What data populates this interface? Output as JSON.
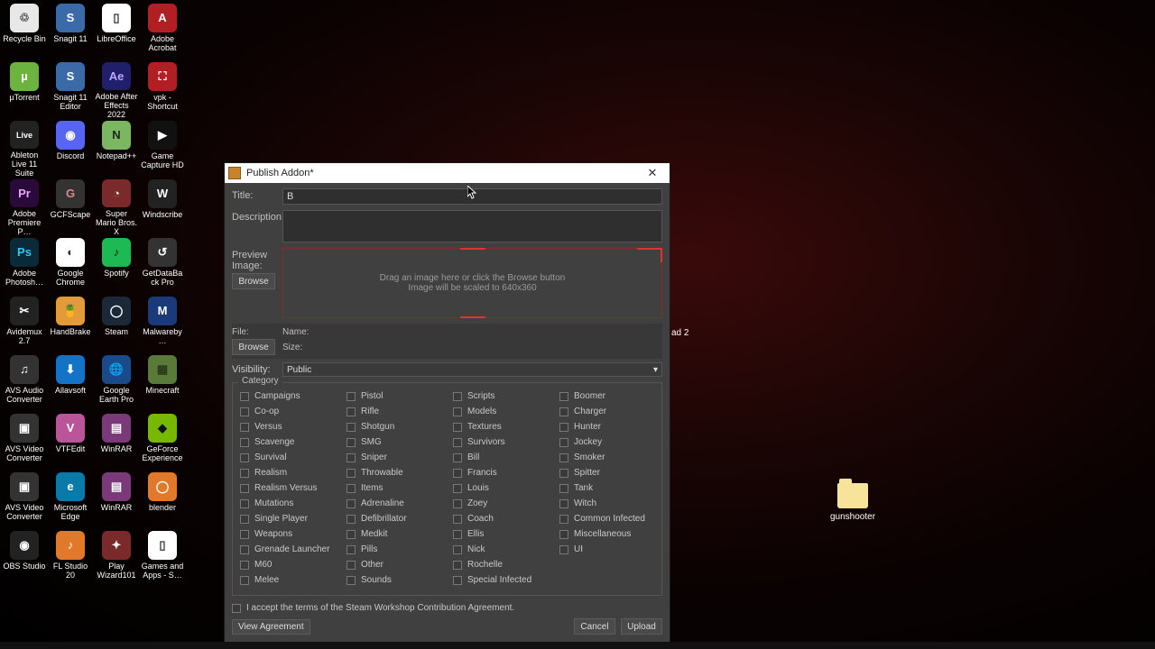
{
  "desktop": {
    "icons": [
      {
        "label": "Recycle Bin",
        "bg": "#e8e8e8",
        "fg": "#555",
        "g": "♲"
      },
      {
        "label": "Snagit 11",
        "bg": "#3a6aa8",
        "fg": "#fff",
        "g": "S"
      },
      {
        "label": "LibreOffice",
        "bg": "#ffffff",
        "fg": "#333",
        "g": "▯"
      },
      {
        "label": "Adobe Acrobat",
        "bg": "#b11f24",
        "fg": "#fff",
        "g": "A"
      },
      {
        "label": "µTorrent",
        "bg": "#6db33f",
        "fg": "#fff",
        "g": "µ"
      },
      {
        "label": "Snagit 11 Editor",
        "bg": "#3a6aa8",
        "fg": "#fff",
        "g": "S"
      },
      {
        "label": "Adobe After Effects 2022",
        "bg": "#1f1f6b",
        "fg": "#b9a6ff",
        "g": "Ae"
      },
      {
        "label": "vpk - Shortcut",
        "bg": "#b11f24",
        "fg": "#fff",
        "g": "⛶"
      },
      {
        "label": "Ableton Live 11 Suite",
        "bg": "#222",
        "fg": "#fff",
        "g": "Live"
      },
      {
        "label": "Discord",
        "bg": "#5865f2",
        "fg": "#fff",
        "g": "◉"
      },
      {
        "label": "Notepad++",
        "bg": "#7bb661",
        "fg": "#222",
        "g": "N"
      },
      {
        "label": "Game Capture HD",
        "bg": "#111",
        "fg": "#fff",
        "g": "▶"
      },
      {
        "label": "Adobe Premiere P…",
        "bg": "#2a0a3a",
        "fg": "#e9a6ff",
        "g": "Pr"
      },
      {
        "label": "GCFScape",
        "bg": "#333",
        "fg": "#d88",
        "g": "G"
      },
      {
        "label": "Super Mario Bros. X",
        "bg": "#7a2a2a",
        "fg": "#fff",
        "g": "◔"
      },
      {
        "label": "Windscribe",
        "bg": "#222",
        "fg": "#fff",
        "g": "W"
      },
      {
        "label": "Adobe Photosh…",
        "bg": "#0a2a3a",
        "fg": "#31c5f4",
        "g": "Ps"
      },
      {
        "label": "Google Chrome",
        "bg": "#fff",
        "fg": "#333",
        "g": "◐"
      },
      {
        "label": "Spotify",
        "bg": "#1db954",
        "fg": "#111",
        "g": "♪"
      },
      {
        "label": "GetDataBack Pro",
        "bg": "#333",
        "fg": "#fff",
        "g": "↺"
      },
      {
        "label": "Avidemux 2.7",
        "bg": "#222",
        "fg": "#fff",
        "g": "✂"
      },
      {
        "label": "HandBrake",
        "bg": "#e39b3a",
        "fg": "#222",
        "g": "🍍"
      },
      {
        "label": "Steam",
        "bg": "#1b2838",
        "fg": "#fff",
        "g": "◯"
      },
      {
        "label": "Malwareby…",
        "bg": "#1a3a7a",
        "fg": "#fff",
        "g": "M"
      },
      {
        "label": "AVS Audio Converter",
        "bg": "#333",
        "fg": "#fff",
        "g": "♫"
      },
      {
        "label": "Allavsoft",
        "bg": "#1373c7",
        "fg": "#fff",
        "g": "⬇"
      },
      {
        "label": "Google Earth Pro",
        "bg": "#1a4a8a",
        "fg": "#fff",
        "g": "🌐"
      },
      {
        "label": "Minecraft",
        "bg": "#5a7a3a",
        "fg": "#2a3a1a",
        "g": "▦"
      },
      {
        "label": "AVS Video Converter",
        "bg": "#333",
        "fg": "#fff",
        "g": "▣"
      },
      {
        "label": "VTFEdit",
        "bg": "#bb5599",
        "fg": "#fff",
        "g": "V"
      },
      {
        "label": "WinRAR",
        "bg": "#7a3a7a",
        "fg": "#fff",
        "g": "▤"
      },
      {
        "label": "GeForce Experience",
        "bg": "#76b900",
        "fg": "#111",
        "g": "◆"
      },
      {
        "label": "AVS Video Converter",
        "bg": "#333",
        "fg": "#fff",
        "g": "▣"
      },
      {
        "label": "Microsoft Edge",
        "bg": "#0a7aa8",
        "fg": "#fff",
        "g": "e"
      },
      {
        "label": "WinRAR",
        "bg": "#7a3a7a",
        "fg": "#fff",
        "g": "▤"
      },
      {
        "label": "blender",
        "bg": "#e07a2a",
        "fg": "#fff",
        "g": "◯"
      },
      {
        "label": "OBS Studio",
        "bg": "#222",
        "fg": "#fff",
        "g": "◉"
      },
      {
        "label": "FL Studio 20",
        "bg": "#e07a2a",
        "fg": "#fff",
        "g": "♪"
      },
      {
        "label": "Play Wizard101",
        "bg": "#7a2a2a",
        "fg": "#fff",
        "g": "✦"
      },
      {
        "label": "Games and Apps - S…",
        "bg": "#fff",
        "fg": "#333",
        "g": "▯"
      }
    ],
    "folder": {
      "label": "gunshooter"
    },
    "peek_label": "ad 2"
  },
  "dialog": {
    "title": "Publish Addon*",
    "labels": {
      "title": "Title:",
      "description": "Description:",
      "preview": "Preview Image:",
      "file": "File:",
      "name": "Name:",
      "size": "Size:",
      "visibility": "Visibility:",
      "category": "Category"
    },
    "title_value": "B",
    "browse": "Browse",
    "preview_hint1": "Drag an image here or click the Browse button",
    "preview_hint2": "Image will be scaled to 640x360",
    "visibility_value": "Public",
    "categories": [
      [
        "Campaigns",
        "Pistol",
        "Scripts",
        "Boomer"
      ],
      [
        "Co-op",
        "Rifle",
        "Models",
        "Charger"
      ],
      [
        "Versus",
        "Shotgun",
        "Textures",
        "Hunter"
      ],
      [
        "Scavenge",
        "SMG",
        "Survivors",
        "Jockey"
      ],
      [
        "Survival",
        "Sniper",
        "Bill",
        "Smoker"
      ],
      [
        "Realism",
        "Throwable",
        "Francis",
        "Spitter"
      ],
      [
        "Realism Versus",
        "Items",
        "Louis",
        "Tank"
      ],
      [
        "Mutations",
        "Adrenaline",
        "Zoey",
        "Witch"
      ],
      [
        "Single Player",
        "Defibrillator",
        "Coach",
        "Common Infected"
      ],
      [
        "Weapons",
        "Medkit",
        "Ellis",
        "Miscellaneous"
      ],
      [
        "Grenade Launcher",
        "Pills",
        "Nick",
        "UI"
      ],
      [
        "M60",
        "Other",
        "Rochelle",
        ""
      ],
      [
        "Melee",
        "Sounds",
        "Special Infected",
        ""
      ]
    ],
    "accept_text": "I accept the terms of the Steam Workshop Contribution Agreement.",
    "view_agreement": "View Agreement",
    "cancel": "Cancel",
    "upload": "Upload"
  }
}
